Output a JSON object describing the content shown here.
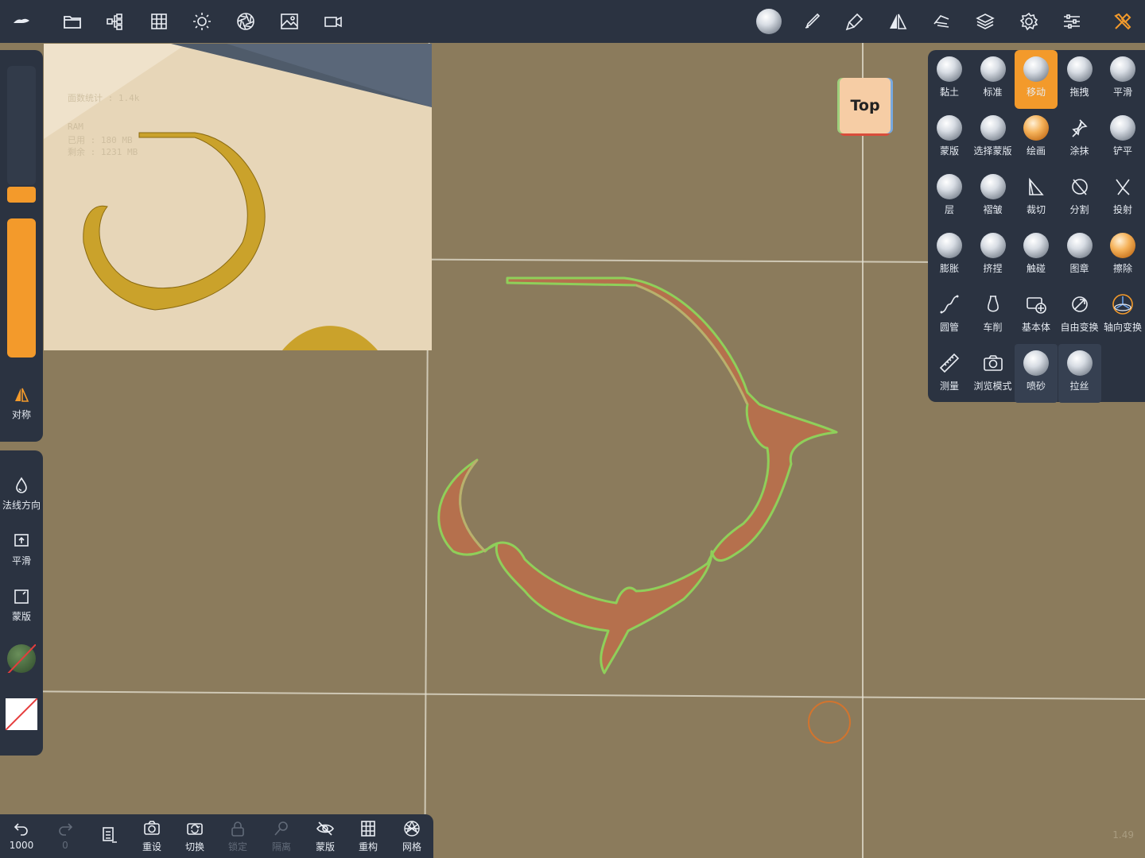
{
  "topbar": {
    "left_icons": [
      "app-logo-icon",
      "folder-icon",
      "scene-tree-icon",
      "grid-icon",
      "sun-icon",
      "aperture-icon",
      "image-icon",
      "video-camera-icon"
    ],
    "right_icons": [
      "material-sphere-icon",
      "brush-icon",
      "stroke-icon",
      "symmetry-icon",
      "hand-icon",
      "layers-icon",
      "settings-icon",
      "sliders-icon",
      "tools-icon"
    ]
  },
  "reference": {
    "stats_line1": "面数统计 : 1.4k",
    "stats_line2": "RAM",
    "stats_line3": "已用 : 180 MB",
    "stats_line4": "剩余 : 1231 MB"
  },
  "view_button": {
    "label": "Top"
  },
  "left_panel": {
    "symmetry_label": "对称",
    "normal_dir_label": "法线方向",
    "smooth_label": "平滑",
    "mask_label": "蒙版"
  },
  "tools": [
    {
      "label": "黏土",
      "icon": "sphere"
    },
    {
      "label": "标准",
      "icon": "sphere"
    },
    {
      "label": "移动",
      "icon": "sphere",
      "active": true
    },
    {
      "label": "拖拽",
      "icon": "sphere"
    },
    {
      "label": "平滑",
      "icon": "sphere"
    },
    {
      "label": "蒙版",
      "icon": "sphere"
    },
    {
      "label": "选择蒙版",
      "icon": "sphere"
    },
    {
      "label": "绘画",
      "icon": "sphere-orange"
    },
    {
      "label": "涂抹",
      "icon": "pin"
    },
    {
      "label": "铲平",
      "icon": "sphere"
    },
    {
      "label": "层",
      "icon": "sphere"
    },
    {
      "label": "褶皱",
      "icon": "sphere"
    },
    {
      "label": "裁切",
      "icon": "cut"
    },
    {
      "label": "分割",
      "icon": "split"
    },
    {
      "label": "投射",
      "icon": "project"
    },
    {
      "label": "膨胀",
      "icon": "sphere"
    },
    {
      "label": "挤捏",
      "icon": "sphere"
    },
    {
      "label": "触碰",
      "icon": "sphere"
    },
    {
      "label": "图章",
      "icon": "sphere"
    },
    {
      "label": "擦除",
      "icon": "sphere-orange"
    },
    {
      "label": "圆管",
      "icon": "tube"
    },
    {
      "label": "车削",
      "icon": "lathe"
    },
    {
      "label": "基本体",
      "icon": "primitive"
    },
    {
      "label": "自由变换",
      "icon": "transform"
    },
    {
      "label": "轴向变换",
      "icon": "gizmo"
    },
    {
      "label": "测量",
      "icon": "ruler"
    },
    {
      "label": "浏览模式",
      "icon": "camera"
    },
    {
      "label": "喷砂",
      "icon": "sphere",
      "boxed": true
    },
    {
      "label": "拉丝",
      "icon": "sphere",
      "boxed": true
    }
  ],
  "bottom_bar": {
    "undo_count": "1000",
    "redo_count": "0",
    "reset_label": "重设",
    "switch_label": "切换",
    "lock_label": "锁定",
    "isolate_label": "隔离",
    "mask_label": "蒙版",
    "remesh_label": "重构",
    "mesh_label": "网格"
  },
  "version": "1.49",
  "colors": {
    "panel": "#2b3341",
    "accent": "#f39a2b",
    "viewport": "#8b7b5c",
    "model": "#b5704d",
    "model_outline": "#8fcf5a"
  }
}
